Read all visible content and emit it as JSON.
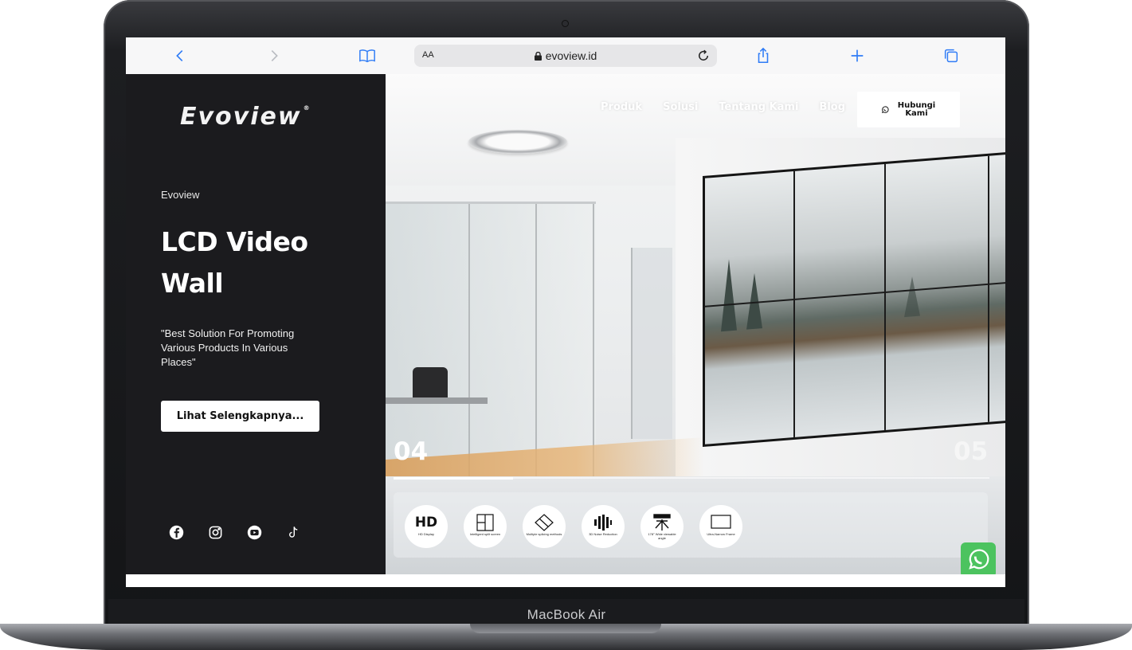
{
  "device": {
    "label": "MacBook Air"
  },
  "browser": {
    "text_size_label": "AA",
    "url": "evoview.id",
    "buttons": [
      "back-icon",
      "forward-icon",
      "bookmarks-icon",
      "reload-icon",
      "share-icon",
      "new-tab-icon",
      "tabs-icon"
    ]
  },
  "site": {
    "logo": "Evoview",
    "brand_small": "Evoview",
    "hero_title": "LCD Video Wall",
    "hero_quote": "\"Best Solution For Promoting Various Products In Various Places\"",
    "cta": "Lihat Selengkapnya...",
    "nav": [
      "Produk",
      "Solusi",
      "Tentang Kami",
      "Blog"
    ],
    "contact_button": "Hubungi Kami",
    "socials": [
      "facebook-icon",
      "instagram-icon",
      "youtube-icon",
      "tiktok-icon"
    ],
    "slider": {
      "current": "04",
      "next": "05",
      "progress": 0.2
    },
    "features": [
      {
        "icon_text": "HD",
        "label": "HD Display"
      },
      {
        "icon_text": "",
        "label": "Intelligent split screen"
      },
      {
        "icon_text": "",
        "label": "Multiple splicing methods"
      },
      {
        "icon_text": "",
        "label": "3D Noise Reduction"
      },
      {
        "icon_text": "",
        "label": "178° Wide viewable angle"
      },
      {
        "icon_text": "",
        "label": "Ultra-Narrow Frame"
      }
    ]
  },
  "colors": {
    "accent": "#2f7cf6",
    "panel": "#1b1b1e",
    "whatsapp": "#4cc35f"
  }
}
